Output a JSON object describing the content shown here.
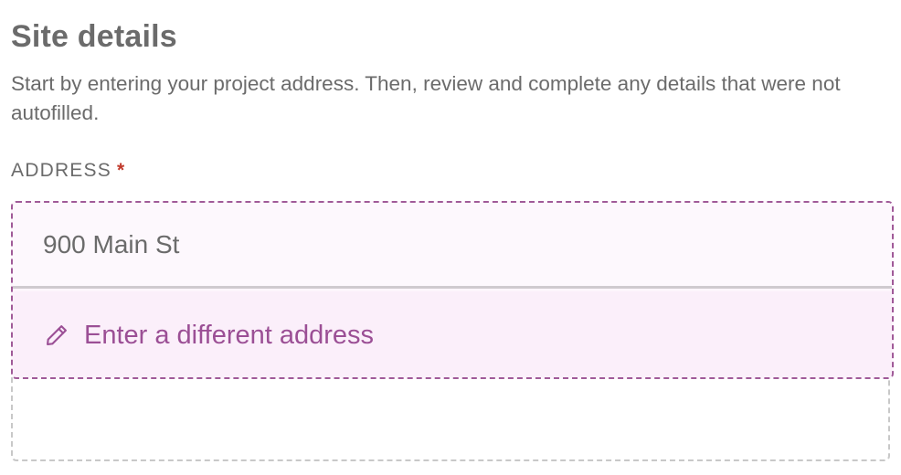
{
  "section": {
    "title": "Site details",
    "intro": "Start by entering your project address. Then, review and complete any details that were not autofilled."
  },
  "address_field": {
    "label": "ADDRESS",
    "required_mark": "*",
    "current_value": "900 Main St",
    "change_action": {
      "label": "Enter a different address",
      "icon": "pencil-icon"
    }
  },
  "colors": {
    "accent": "#9b4f95",
    "required": "#c0392b",
    "text": "#6b6b6b",
    "highlight_bg": "#fbeffa"
  }
}
